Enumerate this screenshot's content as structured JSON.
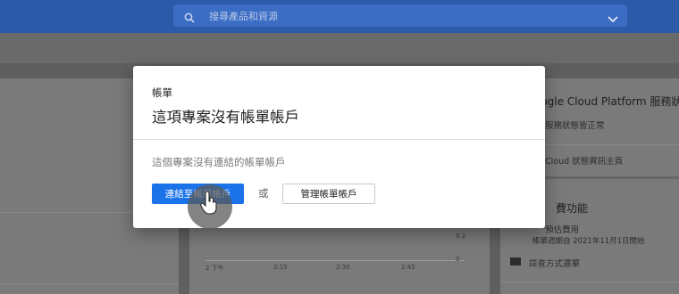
{
  "search": {
    "placeholder": "搜尋產品和資源"
  },
  "background": {
    "status_title": "oogle Cloud Platform 服務狀",
    "status_ok": "服務狀態皆正常",
    "status_link": "Cloud 狀態資訊主頁",
    "billing_title": "費功能",
    "billing_item": "預估費用",
    "billing_period": "帳單週期自 2021年11月1日開始",
    "billing_link": "詳查方式選單",
    "chart_x_labels": [
      "2 下午",
      "2:15",
      "2:30",
      "2:45"
    ],
    "chart_y_labels": [
      "0.2",
      "0"
    ]
  },
  "dialog": {
    "label": "帳單",
    "title": "這項專案沒有帳單帳戶",
    "message": "這個專案沒有連結的帳單帳戶",
    "link_button": "連結至帳單帳戶",
    "or_text": "或",
    "manage_button": "管理帳單帳戶"
  }
}
